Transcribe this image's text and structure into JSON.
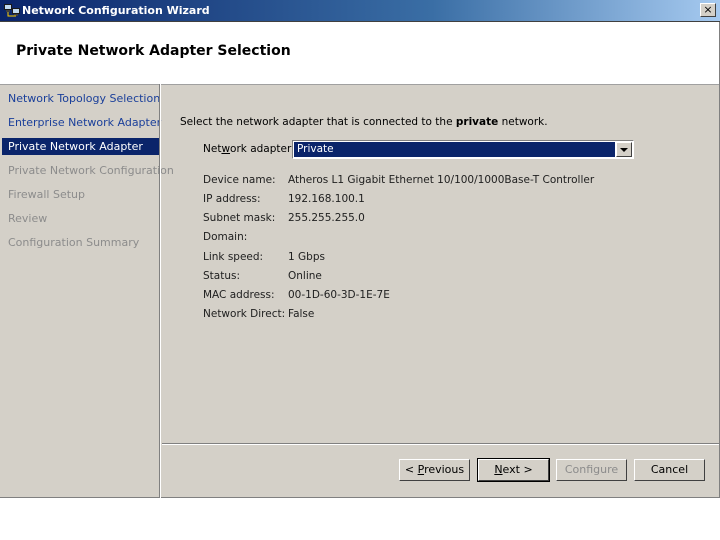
{
  "window": {
    "title": "Network Configuration Wizard",
    "close_glyph": "×"
  },
  "header": {
    "title": "Private Network Adapter Selection"
  },
  "sidebar": {
    "items": [
      {
        "label": "Network Topology Selection",
        "state": "done"
      },
      {
        "label": "Enterprise Network Adapter",
        "state": "done"
      },
      {
        "label": "Private Network Adapter",
        "state": "current"
      },
      {
        "label": "Private Network Configuration",
        "state": "pending"
      },
      {
        "label": "Firewall Setup",
        "state": "pending"
      },
      {
        "label": "Review",
        "state": "pending"
      },
      {
        "label": "Configuration Summary",
        "state": "pending"
      }
    ]
  },
  "main": {
    "instruction_prefix": "Select the network adapter that is connected to the ",
    "instruction_bold": "private",
    "instruction_suffix": " network.",
    "adapter_label_pre": "Net",
    "adapter_label_accel": "w",
    "adapter_label_post": "ork adapter:",
    "adapter_selected": "Private",
    "properties": [
      {
        "label": "Device name:",
        "value": "Atheros L1 Gigabit Ethernet 10/100/1000Base-T Controller"
      },
      {
        "label": "IP address:",
        "value": "192.168.100.1"
      },
      {
        "label": "Subnet mask:",
        "value": "255.255.255.0"
      },
      {
        "label": "Domain:",
        "value": ""
      },
      {
        "label": "Link speed:",
        "value": "1 Gbps"
      },
      {
        "label": "Status:",
        "value": "Online"
      },
      {
        "label": "MAC address:",
        "value": "00-1D-60-3D-1E-7E"
      },
      {
        "label": "Network Direct:",
        "value": "False"
      }
    ]
  },
  "buttons": {
    "previous_pre": "< ",
    "previous_accel": "P",
    "previous_post": "revious",
    "next_accel": "N",
    "next_post": "ext >",
    "configure": "Configure",
    "cancel": "Cancel"
  },
  "colors": {
    "selection": "#0a246a",
    "done_link": "#1a3f9a",
    "disabled_text": "#8c8c8c"
  }
}
